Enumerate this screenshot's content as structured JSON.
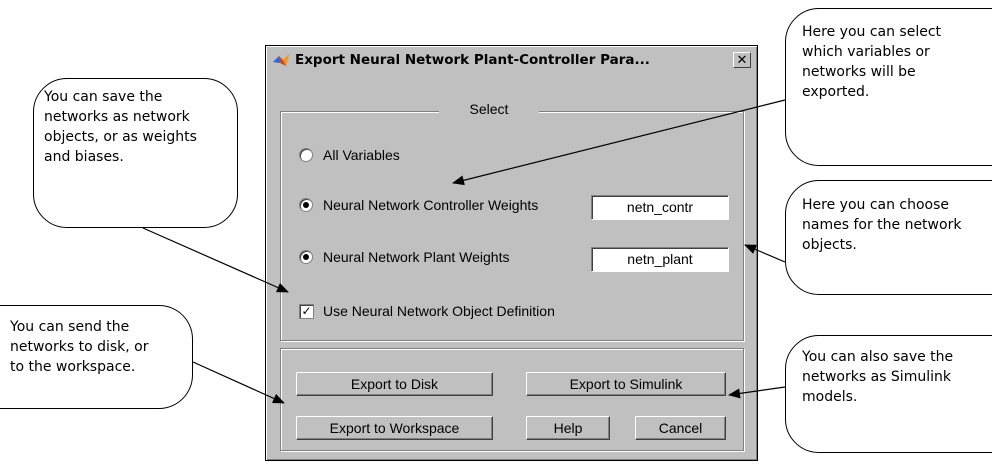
{
  "dialog": {
    "title": "Export Neural Network Plant-Controller Para...",
    "close_glyph": "✕",
    "select_legend": "Select",
    "options": {
      "all_variables": "All Variables",
      "controller_weights": "Neural Network Controller Weights",
      "plant_weights": "Neural Network Plant Weights",
      "object_definition": "Use Neural Network Object Definition"
    },
    "selected": {
      "all_variables": false,
      "controller_weights": true,
      "plant_weights": true,
      "object_definition": true
    },
    "fields": {
      "controller_name": "netn_contr",
      "plant_name": "netn_plant"
    },
    "buttons": {
      "export_disk": "Export to Disk",
      "export_simulink": "Export to Simulink",
      "export_workspace": "Export to Workspace",
      "help": "Help",
      "cancel": "Cancel"
    },
    "icons": {
      "app": "matlab-membrane-icon",
      "close": "close-icon",
      "check": "checkmark-icon"
    }
  },
  "callouts": {
    "save_objects": [
      "You can save the",
      "networks as network",
      "objects, or as weights",
      "and biases."
    ],
    "send_disk": [
      "You can send the",
      "networks to disk, or",
      "to the workspace."
    ],
    "select_vars": [
      "Here you can select",
      "which variables or",
      "networks will be",
      "exported."
    ],
    "choose_names": [
      "Here you can choose",
      "names for the network",
      "objects."
    ],
    "simulink": [
      "You can also save the",
      "networks as Simulink",
      "models."
    ]
  },
  "colors": {
    "dialog_bg": "#c0c0c0",
    "field_bg": "#ffffff",
    "callout_border": "#000000"
  }
}
